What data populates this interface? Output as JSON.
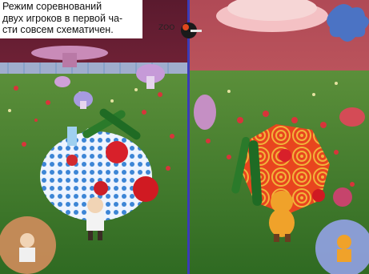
{
  "caption": {
    "lines": [
      "Режим соревнований",
      "двух игроков в первой ча-",
      "сти совсем схематичен."
    ]
  },
  "hud": {
    "center_logo_text": "ZOO"
  },
  "colors": {
    "sky": "#7a1f37",
    "grass": "#3f7a2a",
    "divider": "#3b3bb8",
    "fence": "#a8c6e8"
  },
  "icons": {
    "left_player_badge": "character-portrait-icon",
    "right_player_badge": "character-portrait-icon",
    "center_logo": "game-logo-icon"
  }
}
